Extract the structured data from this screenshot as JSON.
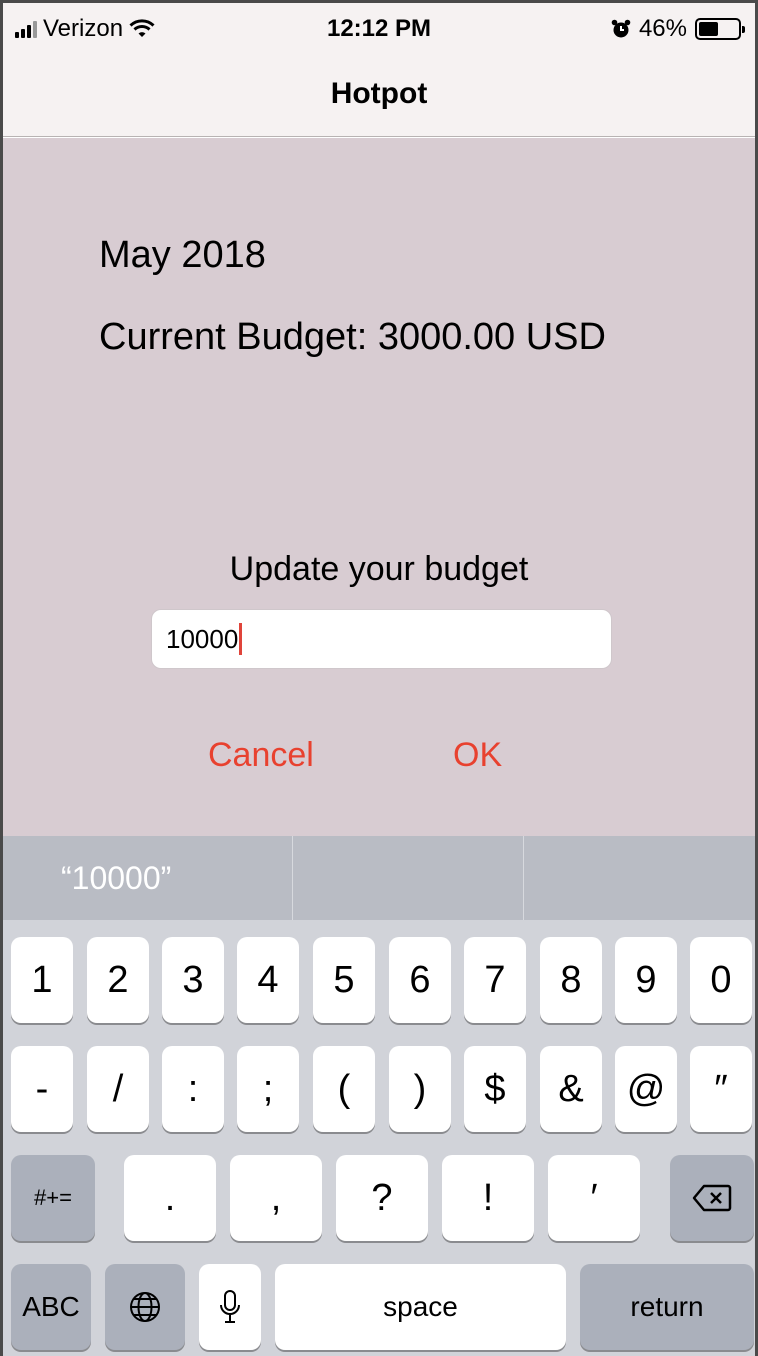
{
  "status_bar": {
    "carrier": "Verizon",
    "time": "12:12 PM",
    "battery": "46%",
    "battery_level": 0.46
  },
  "nav": {
    "title": "Hotpot"
  },
  "main": {
    "month": "May 2018",
    "current_budget": "Current Budget: 3000.00 USD",
    "update_label": "Update your budget",
    "budget_value": "10000",
    "cancel_label": "Cancel",
    "ok_label": "OK"
  },
  "suggestions": [
    "“10000”",
    "",
    ""
  ],
  "keyboard": {
    "row1": [
      "1",
      "2",
      "3",
      "4",
      "5",
      "6",
      "7",
      "8",
      "9",
      "0"
    ],
    "row2": [
      "-",
      "/",
      ":",
      ";",
      "(",
      ")",
      "$",
      "&",
      "@",
      "″"
    ],
    "row3": [
      "#+=",
      ".",
      ",",
      "?",
      "!",
      "′"
    ],
    "row4": {
      "abc": "ABC",
      "space": "space",
      "return": "return"
    },
    "icons": [
      "delete-icon",
      "globe-icon",
      "microphone-icon"
    ]
  },
  "colors": {
    "accent": "#e8412f",
    "background": "#d8ccd2",
    "bar": "#f6f2f2"
  }
}
